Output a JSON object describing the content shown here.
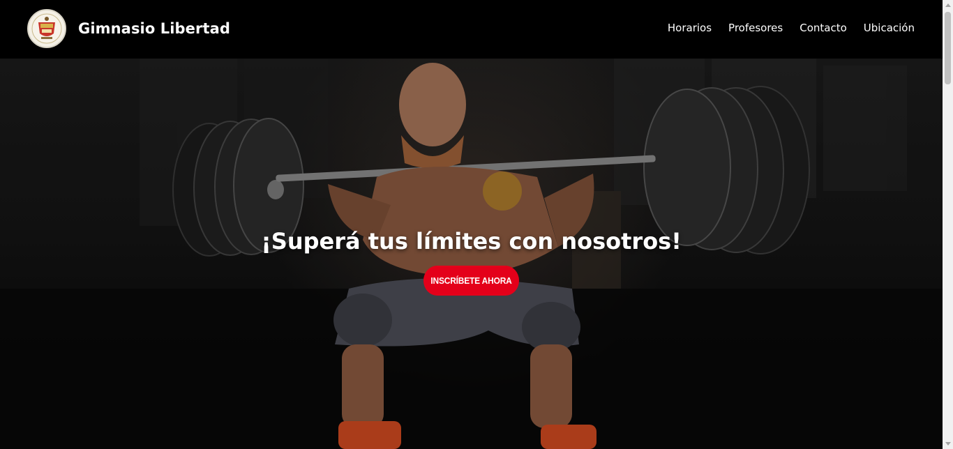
{
  "brand": {
    "name": "Gimnasio Libertad",
    "logo_icon": "gym-crest-logo"
  },
  "nav": {
    "items": [
      {
        "label": "Horarios"
      },
      {
        "label": "Profesores"
      },
      {
        "label": "Contacto"
      },
      {
        "label": "Ubicación"
      }
    ]
  },
  "hero": {
    "title": "¡Superá tus límites con nosotros!",
    "cta_label": "INSCRÍBETE AHORA",
    "background_image": "weightlifter-squat-photo"
  },
  "colors": {
    "nav_background": "#000000",
    "accent": "#e4001a",
    "text": "#ffffff"
  }
}
